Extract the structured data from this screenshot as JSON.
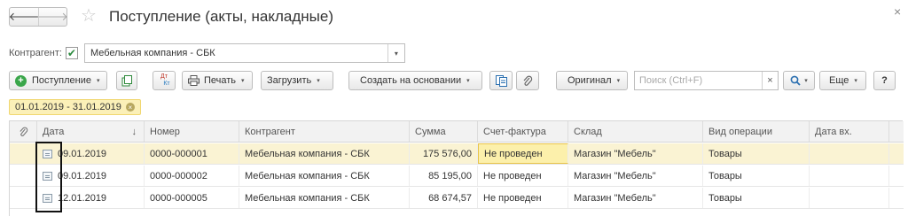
{
  "header": {
    "back_icon": "arrow-left-icon",
    "forward_icon": "arrow-right-icon",
    "favorite_icon": "star-icon",
    "title": "Поступление (акты, накладные)",
    "close_icon": "close-icon"
  },
  "filter": {
    "label": "Контрагент:",
    "checked": true,
    "value": "Мебельная компания - СБК"
  },
  "toolbar": {
    "create_label": "Поступление",
    "print_label": "Печать",
    "load_label": "Загрузить",
    "based_on_label": "Создать на основании",
    "original_label": "Оригинал",
    "search_placeholder": "Поиск (Ctrl+F)",
    "more_label": "Еще",
    "help_label": "?",
    "dt_label": "Дт",
    "kt_label": "Кт"
  },
  "period": {
    "label": "01.01.2019 - 31.01.2019"
  },
  "table": {
    "columns": [
      "Дата",
      "Номер",
      "Контрагент",
      "Сумма",
      "Счет-фактура",
      "Склад",
      "Вид операции",
      "Дата вх."
    ],
    "sort_indicator": "↓",
    "rows": [
      {
        "date": "09.01.2019",
        "number": "0000-000001",
        "counterparty": "Мебельная компания - СБК",
        "sum": "175 576,00",
        "invoice": "Не проведен",
        "warehouse": "Магазин \"Мебель\"",
        "operation": "Товары",
        "in_date": ""
      },
      {
        "date": "09.01.2019",
        "number": "0000-000002",
        "counterparty": "Мебельная компания - СБК",
        "sum": "85 195,00",
        "invoice": "Не проведен",
        "warehouse": "Магазин \"Мебель\"",
        "operation": "Товары",
        "in_date": ""
      },
      {
        "date": "12.01.2019",
        "number": "0000-000005",
        "counterparty": "Мебельная компания - СБК",
        "sum": "68 674,57",
        "invoice": "Не проведен",
        "warehouse": "Магазин \"Мебель\"",
        "operation": "Товары",
        "in_date": ""
      }
    ]
  },
  "colors": {
    "selected_row": "#faf3d3",
    "active_cell": "#fcf0ab",
    "period_tag": "#fbf0b8",
    "check": "#2b8a3e",
    "add_icon": "#3aa64a"
  }
}
